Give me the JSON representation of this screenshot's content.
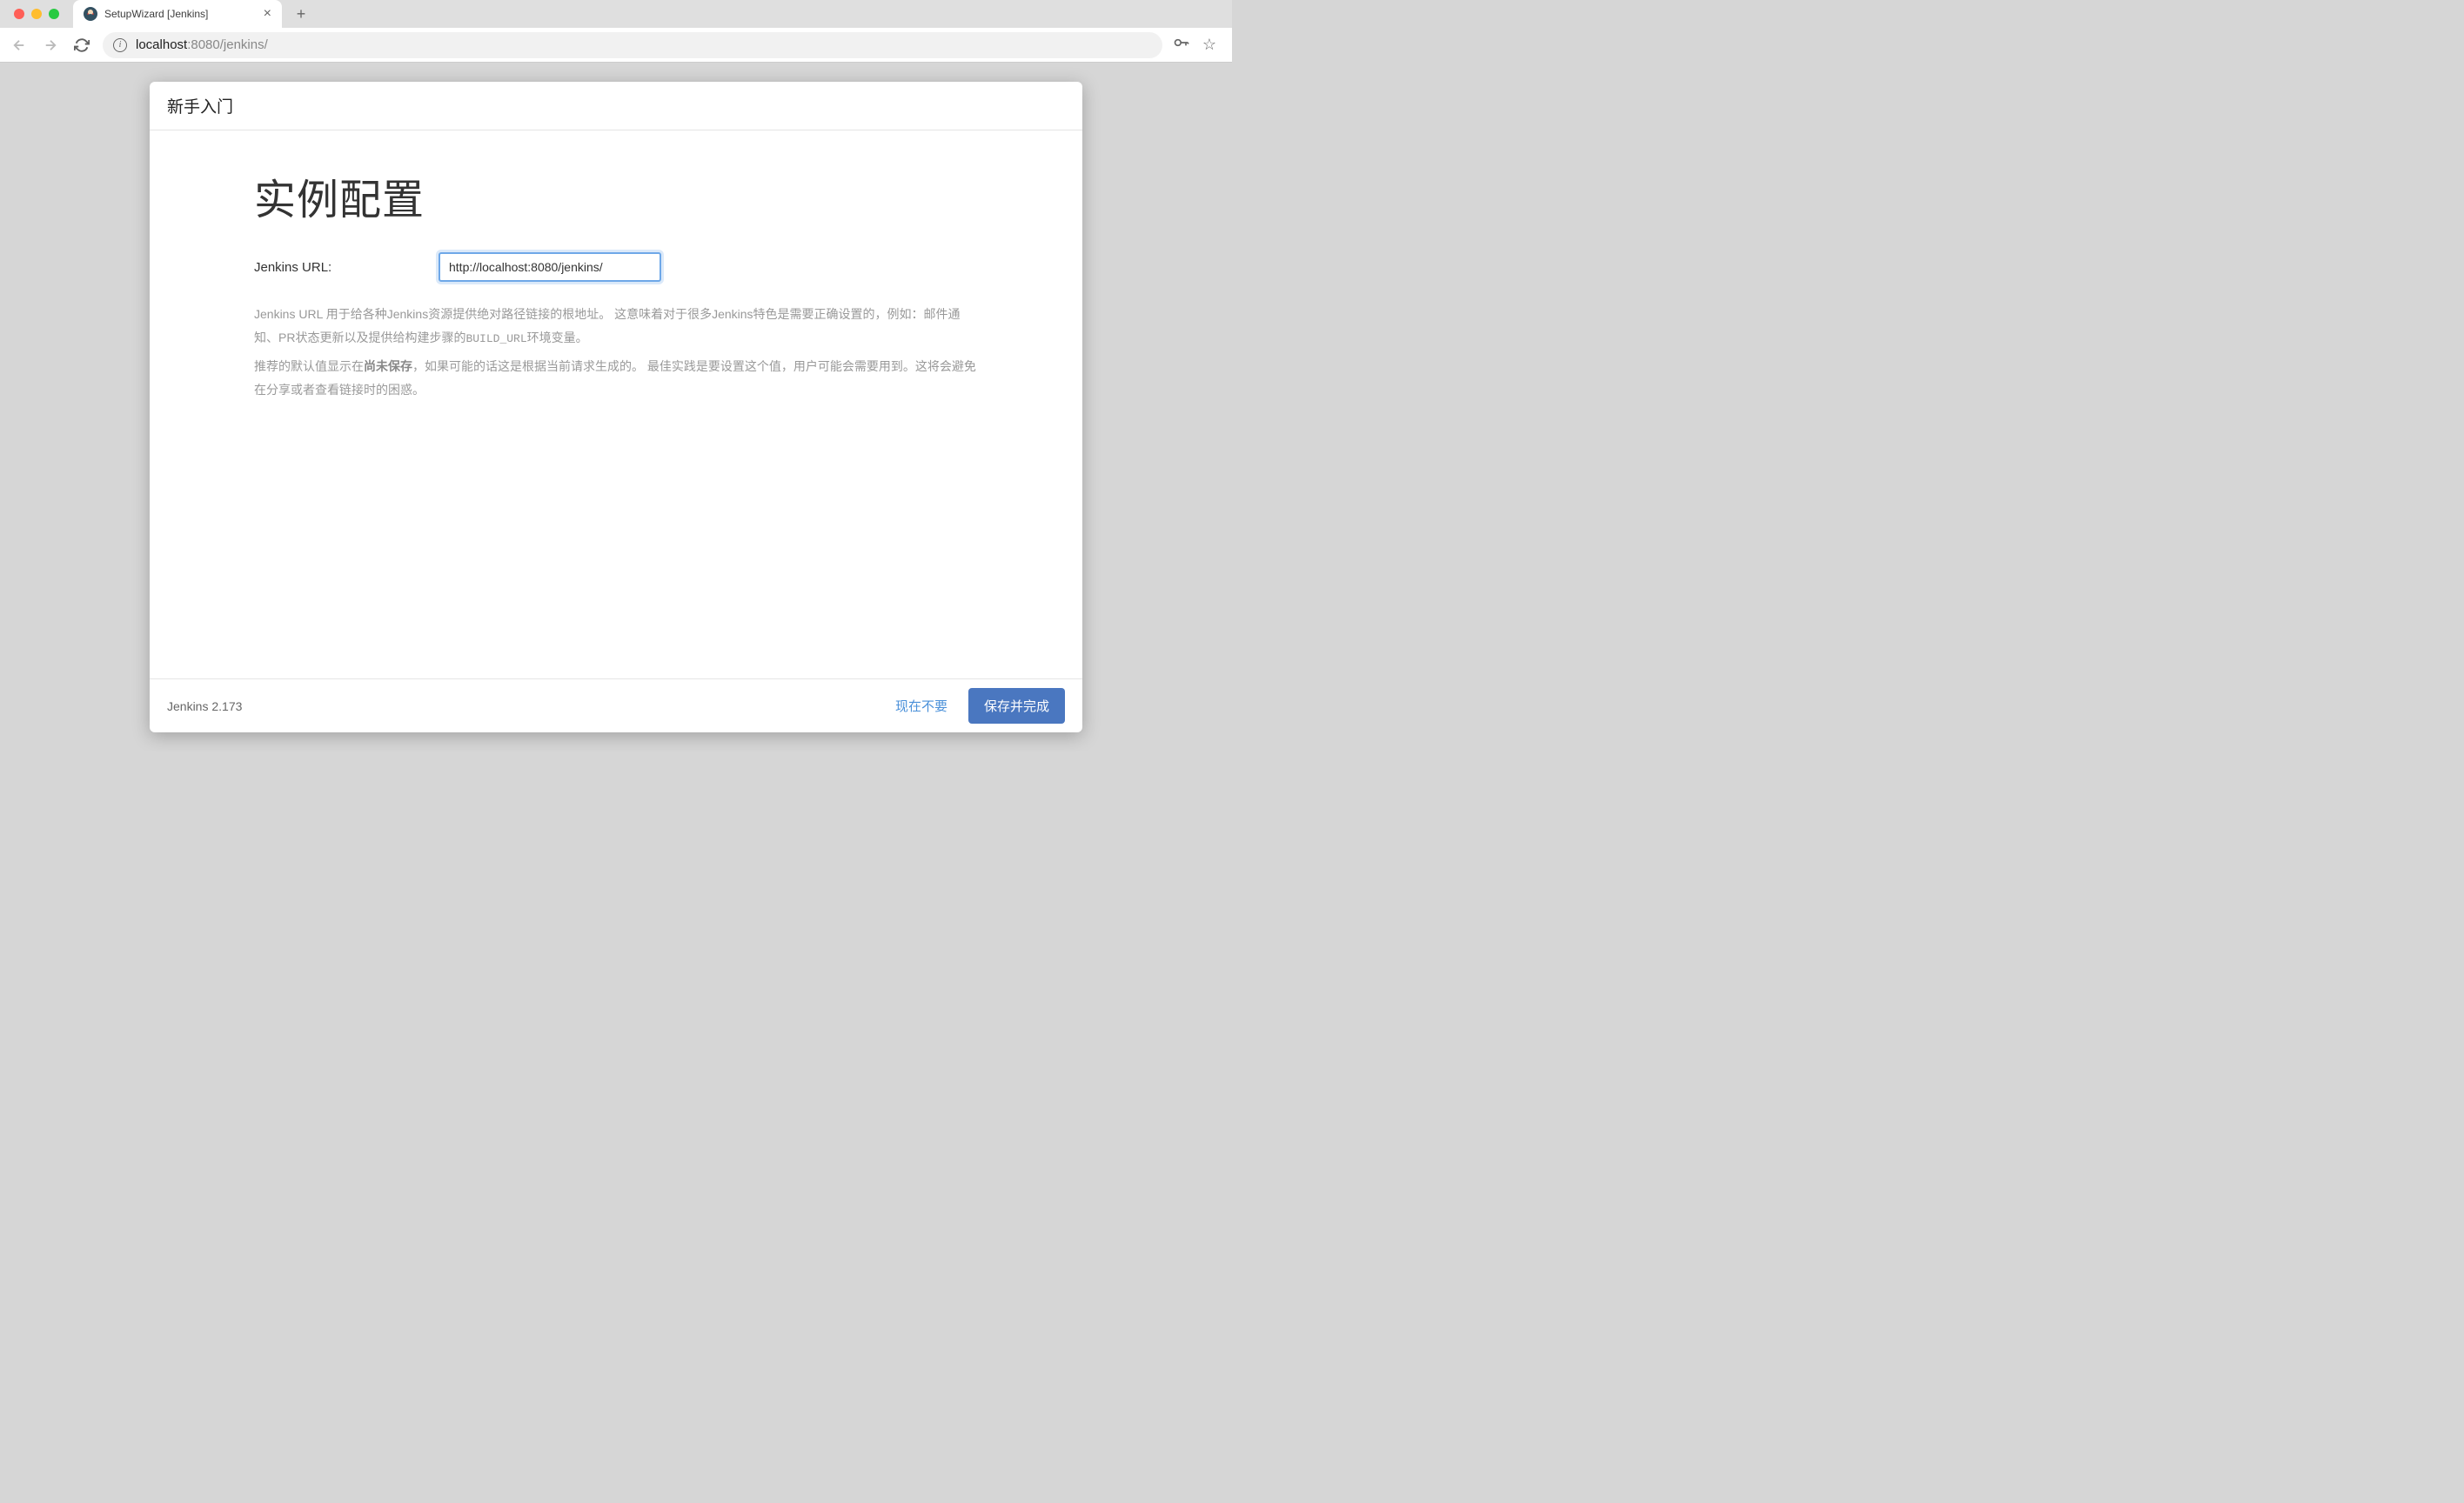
{
  "browser": {
    "tab_title": "SetupWizard [Jenkins]",
    "url_domain": "localhost",
    "url_port_path": ":8080/jenkins/"
  },
  "modal": {
    "header_title": "新手入门",
    "main_heading": "实例配置",
    "form": {
      "url_label": "Jenkins URL:",
      "url_value": "http://localhost:8080/jenkins/"
    },
    "description": {
      "para1_part1": "Jenkins URL 用于给各种Jenkins资源提供绝对路径链接的根地址。 这意味着对于很多Jenkins特色是需要正确设置的，例如：邮件通知、PR状态更新以及提供给构建步骤的",
      "para1_code": "BUILD_URL",
      "para1_part2": "环境变量。",
      "para2_part1": "推荐的默认值显示在",
      "para2_emphasis": "尚未保存",
      "para2_part2": "，如果可能的话这是根据当前请求生成的。 最佳实践是要设置这个值，用户可能会需要用到。这将会避免在分享或者查看链接时的困惑。"
    },
    "footer": {
      "version": "Jenkins 2.173",
      "skip_button": "现在不要",
      "save_button": "保存并完成"
    }
  }
}
